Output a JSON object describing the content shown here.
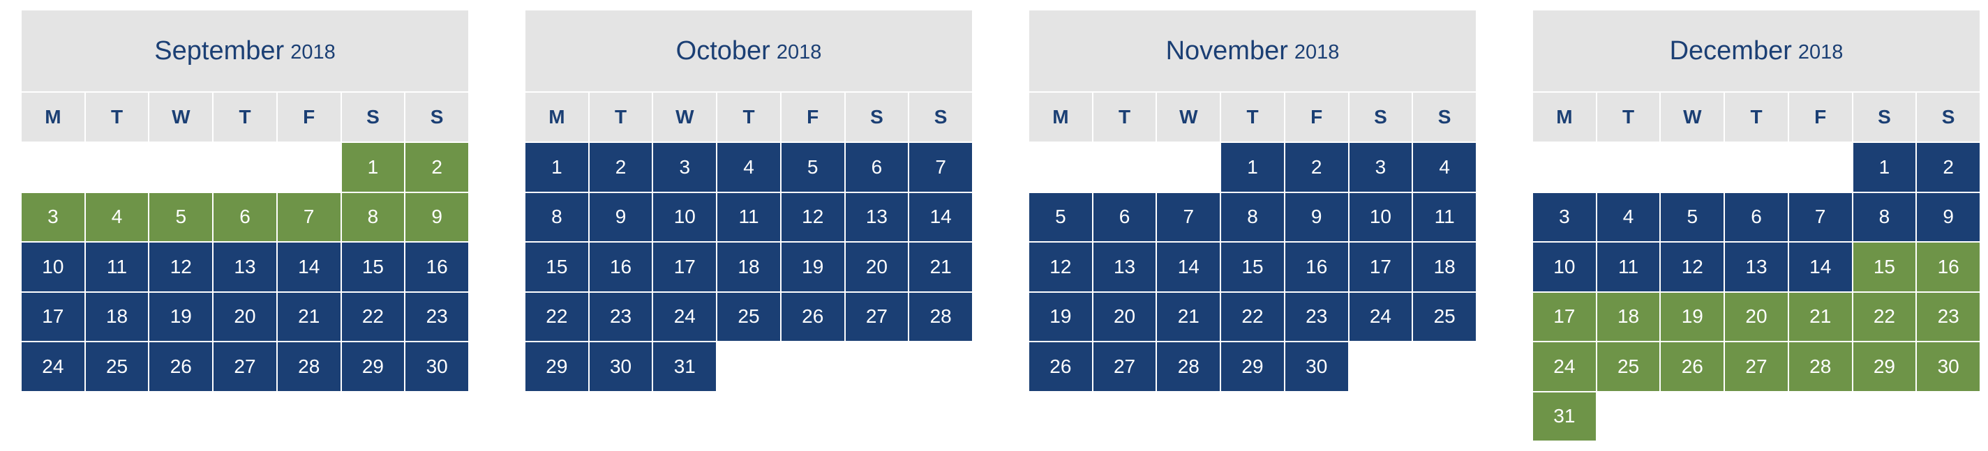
{
  "colors": {
    "header_bg": "#e4e4e4",
    "header_text": "#1b3f74",
    "default_day": "#1b3f74",
    "highlighted_day": "#6e9448",
    "day_text": "#ffffff"
  },
  "weekdays": [
    "M",
    "T",
    "W",
    "T",
    "F",
    "S",
    "S"
  ],
  "months": [
    {
      "name": "September",
      "year": "2018",
      "first_weekday_index": 5,
      "day_count": 30,
      "highlighted_days": [
        1,
        2,
        3,
        4,
        5,
        6,
        7,
        8,
        9
      ]
    },
    {
      "name": "October",
      "year": "2018",
      "first_weekday_index": 0,
      "day_count": 31,
      "highlighted_days": []
    },
    {
      "name": "November",
      "year": "2018",
      "first_weekday_index": 3,
      "day_count": 30,
      "highlighted_days": []
    },
    {
      "name": "December",
      "year": "2018",
      "first_weekday_index": 5,
      "day_count": 31,
      "highlighted_days": [
        15,
        16,
        17,
        18,
        19,
        20,
        21,
        22,
        23,
        24,
        25,
        26,
        27,
        28,
        29,
        30,
        31
      ]
    }
  ]
}
